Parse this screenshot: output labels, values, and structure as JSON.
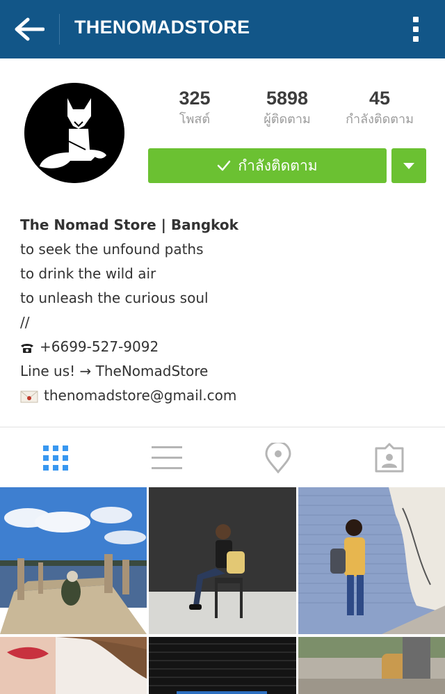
{
  "topbar": {
    "title": "THENOMADSTORE"
  },
  "stats": [
    {
      "value": "325",
      "label": "โพสต์"
    },
    {
      "value": "5898",
      "label": "ผู้ติดตาม"
    },
    {
      "value": "45",
      "label": "กำลังติดตาม"
    }
  ],
  "follow": {
    "label": "กำลังติดตาม"
  },
  "bio": {
    "name": "The Nomad Store | Bangkok",
    "lines": [
      "to seek the unfound paths",
      "to drink the wild air",
      "to unleash the curious soul",
      "//"
    ],
    "phone": "+6699-527-9092",
    "line": "Line us! → TheNomadStore",
    "email": "thenomadstore@gmail.com"
  },
  "colors": {
    "topbar": "#125688",
    "follow_green": "#6bc132",
    "active_tab_blue": "#3897f0"
  },
  "tabs": [
    {
      "icon": "grid-icon",
      "active": true
    },
    {
      "icon": "list-icon",
      "active": false
    },
    {
      "icon": "location-pin-icon",
      "active": false
    },
    {
      "icon": "tagged-person-icon",
      "active": false
    }
  ]
}
